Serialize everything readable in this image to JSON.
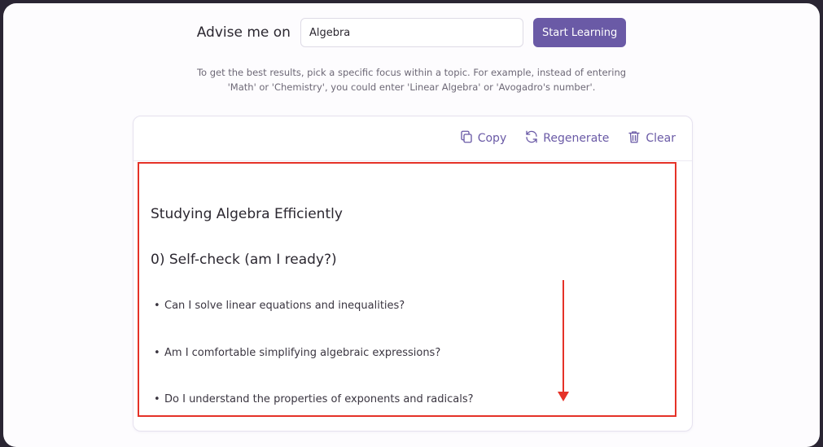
{
  "header": {
    "prompt_label": "Advise me on",
    "topic_value": "Algebra",
    "start_label": "Start Learning"
  },
  "hint": {
    "line1": "To get the best results, pick a specific focus within a topic. For example, instead of entering",
    "line2": "'Math' or 'Chemistry', you could enter 'Linear Algebra' or 'Avogadro's number'."
  },
  "toolbar": {
    "copy_label": "Copy",
    "regenerate_label": "Regenerate",
    "clear_label": "Clear"
  },
  "content": {
    "title": "Studying Algebra Efficiently",
    "section_heading": "0) Self-check (am I ready?)",
    "items": [
      "Can I solve linear equations and inequalities?",
      "Am I comfortable simplifying algebraic expressions?",
      "Do I understand the properties of exponents and radicals?"
    ]
  },
  "colors": {
    "accent": "#6a5aa6",
    "annotation": "#e53228",
    "backdrop": "#2a2533"
  },
  "icons": [
    "copy-icon",
    "refresh-icon",
    "trash-icon"
  ]
}
